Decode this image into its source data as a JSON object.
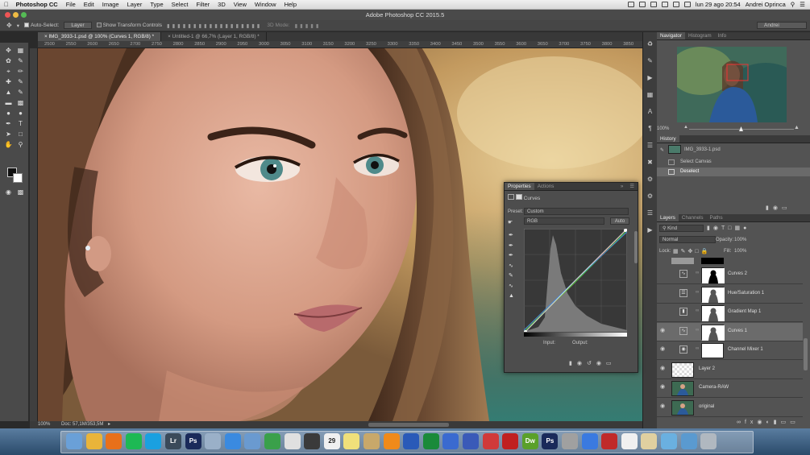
{
  "menubar": {
    "apple": "",
    "app": "Photoshop CC",
    "items": [
      "File",
      "Edit",
      "Image",
      "Layer",
      "Type",
      "Select",
      "Filter",
      "3D",
      "View",
      "Window",
      "Help"
    ],
    "datetime": "lun 29 ago  20:54",
    "user": "Andrei Oprinca"
  },
  "window": {
    "title": "Adobe Photoshop CC 2015.5"
  },
  "options": {
    "auto_select_label": "Auto-Select:",
    "auto_select_value": "Layer",
    "transform_label": "Show Transform Controls",
    "mode_3d": "3D Mode:",
    "workspace": "Andrei"
  },
  "tabs": [
    {
      "label": "IMG_3933-1.psd @ 100% (Curves 1, RGB/8) *"
    },
    {
      "label": "Untitled-1 @ 66,7% (Layer 1, RGB/8) *"
    }
  ],
  "ruler": {
    "ticks": [
      "2500",
      "2550",
      "2600",
      "2650",
      "2700",
      "2750",
      "2800",
      "2850",
      "2900",
      "2950",
      "3000",
      "3050",
      "3100",
      "3150",
      "3200",
      "3250",
      "3300",
      "3350",
      "3400",
      "3450",
      "3500",
      "3550",
      "3600",
      "3650",
      "3700",
      "3750",
      "3800",
      "3850"
    ]
  },
  "status": {
    "zoom": "100%",
    "doc": "Doc: 57,1M/353,5M"
  },
  "navigator": {
    "tabs": [
      "Navigator",
      "Histogram",
      "Info"
    ],
    "zoom": "100%"
  },
  "history": {
    "title": "History",
    "snapshot": "IMG_3933-1.psd",
    "items": [
      "Select Canvas",
      "Deselect"
    ]
  },
  "properties": {
    "tabs": [
      "Properties",
      "Actions"
    ],
    "adjustment": "Curves",
    "preset_label": "Preset:",
    "preset_value": "Custom",
    "channel": "RGB",
    "auto": "Auto",
    "input": "Input:",
    "output": "Output:"
  },
  "layers": {
    "tabs": [
      "Layers",
      "Channels",
      "Paths"
    ],
    "kind": "Kind",
    "blend": "Normal",
    "opacity_label": "Opacity:",
    "opacity": "100%",
    "lock_label": "Lock:",
    "fill_label": "Fill:",
    "fill": "100%",
    "items": [
      {
        "name": "Curves 2",
        "type": "curves",
        "vis": false
      },
      {
        "name": "Hue/Saturation 1",
        "type": "huesat",
        "vis": false
      },
      {
        "name": "Gradient Map 1",
        "type": "gradient",
        "vis": false
      },
      {
        "name": "Curves 1",
        "type": "curves",
        "vis": true,
        "selected": true
      },
      {
        "name": "Channel Mixer 1",
        "type": "mixer",
        "vis": true
      },
      {
        "name": "Layer 2",
        "type": "pixel",
        "vis": true
      },
      {
        "name": "Camera-RAW",
        "type": "photo",
        "vis": true
      },
      {
        "name": "original",
        "type": "photo",
        "vis": true
      }
    ]
  },
  "dock": {
    "icons": [
      "Finder",
      "Chrome",
      "Firefox",
      "Spotify",
      "Skype",
      "Lr",
      "Ps",
      "Preview",
      "Safari",
      "Mail",
      "Camtasia",
      "Photos",
      "Activity",
      "Calendar",
      "Notes",
      "Files",
      "VLC",
      "Word",
      "Excel",
      "Keynote",
      "Word-Doc",
      "Nuke",
      "FileZilla",
      "Dw",
      "Ps",
      "Remote",
      "Dropbox",
      "CC",
      "Doc",
      "Script",
      "Downloads",
      "Folder",
      "Trash"
    ],
    "calendar_day": "29"
  },
  "colors": {
    "accent": "#4b9ad6",
    "panel": "#535353",
    "toolbar": "#4a4a4a"
  }
}
